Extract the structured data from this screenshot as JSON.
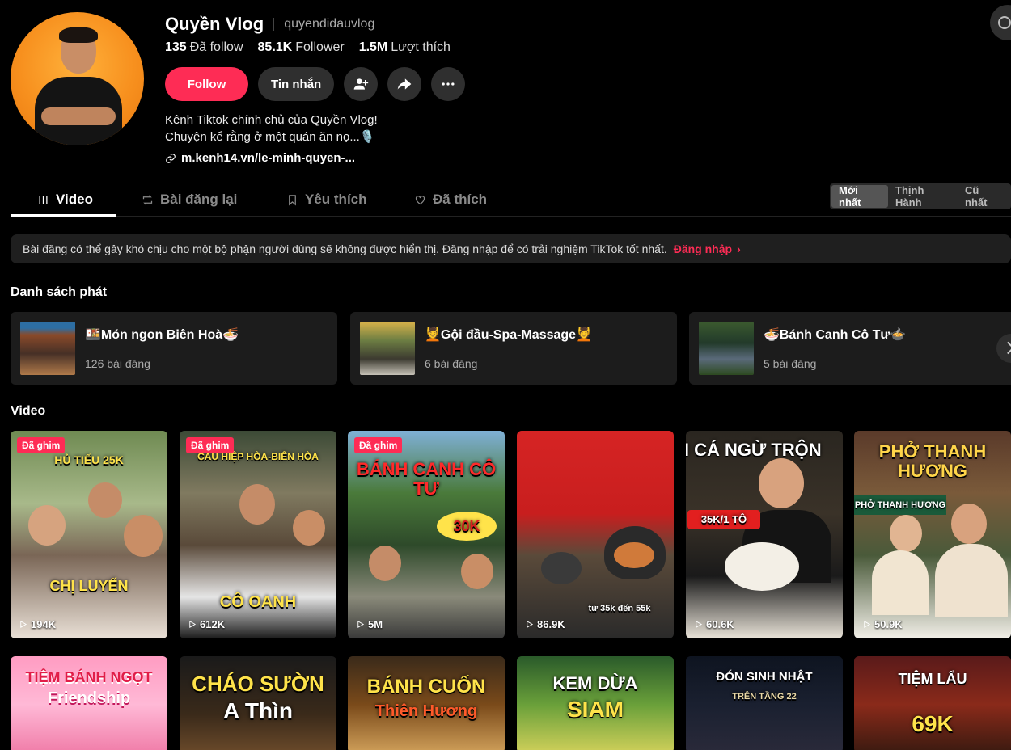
{
  "profile": {
    "name": "Quyền Vlog",
    "handle": "quyendidauvlog",
    "stats": [
      {
        "value": "135",
        "label": "Đã follow"
      },
      {
        "value": "85.1K",
        "label": "Follower"
      },
      {
        "value": "1.5M",
        "label": "Lượt thích"
      }
    ],
    "follow_label": "Follow",
    "message_label": "Tin nhắn",
    "bio_line1": "Kênh Tiktok chính chủ của Quyền Vlog!",
    "bio_line2": "Chuyện kể rằng ở một quán ăn nọ...🎙️",
    "link": "m.kenh14.vn/le-minh-quyen-..."
  },
  "tabs": [
    {
      "label": "Video",
      "icon": "grid-icon"
    },
    {
      "label": "Bài đăng lại",
      "icon": "repost-icon"
    },
    {
      "label": "Yêu thích",
      "icon": "bookmark-icon"
    },
    {
      "label": "Đã thích",
      "icon": "heart-icon"
    }
  ],
  "sort": [
    "Mới nhất",
    "Thịnh Hành",
    "Cũ nhất"
  ],
  "notice": {
    "text": "Bài đăng có thể gây khó chịu cho một bộ phận người dùng sẽ không được hiển thị. Đăng nhập để có trải nghiệm TikTok tốt nhất.",
    "login": "Đăng nhập"
  },
  "playlist_section": "Danh sách phát",
  "playlists": [
    {
      "title": "🍱Món ngon Biên Hoà🍜",
      "count": "126 bài đăng"
    },
    {
      "title": "💆Gội đầu-Spa-Massage💆",
      "count": "6 bài đăng"
    },
    {
      "title": "🍜Bánh Canh Cô Tư🍲",
      "count": "5 bài đăng"
    }
  ],
  "video_section": "Video",
  "pinned_label": "Đã ghim",
  "videos": [
    {
      "caption": "HỦ TIẾU 25K",
      "caption2": "CHỊ LUYẾN",
      "views": "194K",
      "pinned": true
    },
    {
      "caption": "CÂU HIỆP HÒA-BIÊN HÒA",
      "caption2": "CÔ OANH",
      "views": "612K",
      "pinned": true
    },
    {
      "caption": "BÁNH CANH CÔ TƯ",
      "caption2": "30K",
      "views": "5M",
      "pinned": true
    },
    {
      "caption": "",
      "caption2": "từ 35k đến 55k",
      "views": "86.9K",
      "pinned": false
    },
    {
      "caption": "BÚN CÁ NGỪ TRỘN",
      "caption2": "35K/1 TÔ",
      "views": "60.6K",
      "pinned": false
    },
    {
      "caption": "PHỞ THANH HƯƠNG",
      "caption2": "PHỞ THANH HƯƠNG",
      "views": "50.9K",
      "pinned": false
    },
    {
      "caption": "TIỆM BÁNH NGỌT",
      "caption2": "Friendship"
    },
    {
      "caption": "CHÁO SƯỜN",
      "caption2": "A Thìn"
    },
    {
      "caption": "BÁNH CUỐN",
      "caption2": "Thiên Hương"
    },
    {
      "caption": "KEM DỪA",
      "caption2": "SIAM"
    },
    {
      "caption": "ĐÓN SINH NHẬT",
      "caption2": "TRÊN TẦNG 22"
    },
    {
      "caption": "TIỆM LẨU",
      "caption2": "69K"
    }
  ],
  "colors": {
    "accent": "#fe2c55",
    "background": "#000000",
    "card": "#1c1c1c"
  }
}
